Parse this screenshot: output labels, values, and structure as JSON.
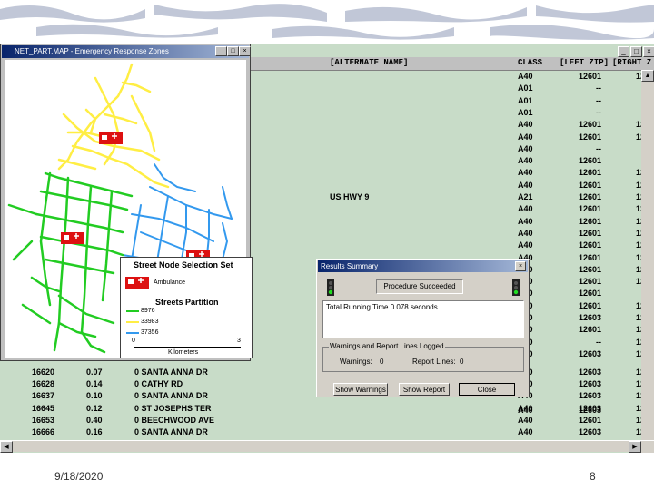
{
  "table": {
    "headers": {
      "alternate_name": "[ALTERNATE NAME]",
      "class": "CLASS",
      "left_zip": "[LEFT ZIP]",
      "right_zip": "[RIGHT Z"
    },
    "top_rows": [
      {
        "alt": "",
        "class": "A40",
        "lzip": "12601",
        "rzip": "12"
      },
      {
        "alt": "",
        "class": "A01",
        "lzip": "--",
        "rzip": ""
      },
      {
        "alt": "",
        "class": "A01",
        "lzip": "--",
        "rzip": ""
      },
      {
        "alt": "",
        "class": "A01",
        "lzip": "--",
        "rzip": ""
      },
      {
        "alt": "",
        "class": "A40",
        "lzip": "12601",
        "rzip": "12"
      },
      {
        "alt": "",
        "class": "A40",
        "lzip": "12601",
        "rzip": "12"
      },
      {
        "alt": "",
        "class": "A40",
        "lzip": "--",
        "rzip": ""
      },
      {
        "alt": "",
        "class": "A40",
        "lzip": "12601",
        "rzip": ""
      },
      {
        "alt": "",
        "class": "A40",
        "lzip": "12601",
        "rzip": "12"
      },
      {
        "alt": "",
        "class": "A40",
        "lzip": "12601",
        "rzip": "12"
      },
      {
        "alt": "US HWY 9",
        "class": "A21",
        "lzip": "12601",
        "rzip": "12"
      },
      {
        "alt": "",
        "class": "A40",
        "lzip": "12601",
        "rzip": "12"
      },
      {
        "alt": "",
        "class": "A40",
        "lzip": "12601",
        "rzip": "12"
      },
      {
        "alt": "",
        "class": "A40",
        "lzip": "12601",
        "rzip": "12"
      },
      {
        "alt": "",
        "class": "A40",
        "lzip": "12601",
        "rzip": "12"
      },
      {
        "alt": "",
        "class": "A40",
        "lzip": "12601",
        "rzip": "12"
      },
      {
        "alt": "",
        "class": "A40",
        "lzip": "12601",
        "rzip": "12"
      },
      {
        "alt": "",
        "class": "A40",
        "lzip": "12601",
        "rzip": "12"
      },
      {
        "alt": "",
        "class": "A40",
        "lzip": "12601",
        "rzip": ""
      },
      {
        "alt": "",
        "class": "A40",
        "lzip": "12601",
        "rzip": "12"
      },
      {
        "alt": "",
        "class": "A40",
        "lzip": "12603",
        "rzip": "12"
      },
      {
        "alt": "",
        "class": "A40",
        "lzip": "12601",
        "rzip": "12"
      },
      {
        "alt": "",
        "class": "A40",
        "lzip": "--",
        "rzip": "12"
      },
      {
        "alt": "",
        "class": "A40",
        "lzip": "12603",
        "rzip": "12"
      }
    ],
    "bottom_rows": [
      {
        "id": "16620",
        "len": "0.07",
        "name": "0 SANTA ANNA DR",
        "class": "A40",
        "lzip": "12603",
        "rzip": "12"
      },
      {
        "id": "16628",
        "len": "0.14",
        "name": "0 CATHY RD",
        "class": "A40",
        "lzip": "12603",
        "rzip": "12"
      },
      {
        "id": "16637",
        "len": "0.10",
        "name": "0 SANTA ANNA DR",
        "class": "A40",
        "lzip": "12603",
        "rzip": "12"
      },
      {
        "id": "16645",
        "len": "0.12",
        "name": "0 ST JOSEPHS TER",
        "class": "A40",
        "lzip": "12603",
        "rzip": "12"
      },
      {
        "id": "16653",
        "len": "0.40",
        "name": "0 BEECHWOOD AVE",
        "class": "A40",
        "lzip": "12601",
        "rzip": "12"
      },
      {
        "id": "16666",
        "len": "0.16",
        "name": "0 SANTA ANNA DR",
        "class": "A40",
        "lzip": "12603",
        "rzip": "12"
      }
    ],
    "extra_class": "A40",
    "extra_lzip": "12603"
  },
  "map_window": {
    "title": "NET_PART.MAP - Emergency Response Zones",
    "legend": {
      "title": "Street Node Selection Set",
      "ambulance_label": "Ambulance",
      "partition_title": "Streets Partition",
      "items": [
        {
          "label": "8976",
          "color": "#22cc22"
        },
        {
          "label": "33983",
          "color": "#ffee44"
        },
        {
          "label": "37356",
          "color": "#3399ee"
        }
      ],
      "scale_start": "0",
      "scale_end": "3",
      "scale_unit": "Kilometers"
    }
  },
  "results_dialog": {
    "title": "Results Summary",
    "status": "Procedure Succeeded",
    "message": "Total Running Time 0.078 seconds.",
    "group_label": "Warnings and Report Lines Logged",
    "warnings_label": "Warnings:",
    "warnings_value": "0",
    "report_label": "Report Lines:",
    "report_value": "0",
    "buttons": {
      "show_warnings": "Show Warnings",
      "show_report": "Show Report",
      "close": "Close"
    }
  },
  "footer": {
    "date": "9/18/2020",
    "page": "8"
  },
  "colors": {
    "green": "#22cc22",
    "yellow": "#ffee44",
    "blue": "#3399ee",
    "ambulance": "#dd1111"
  }
}
